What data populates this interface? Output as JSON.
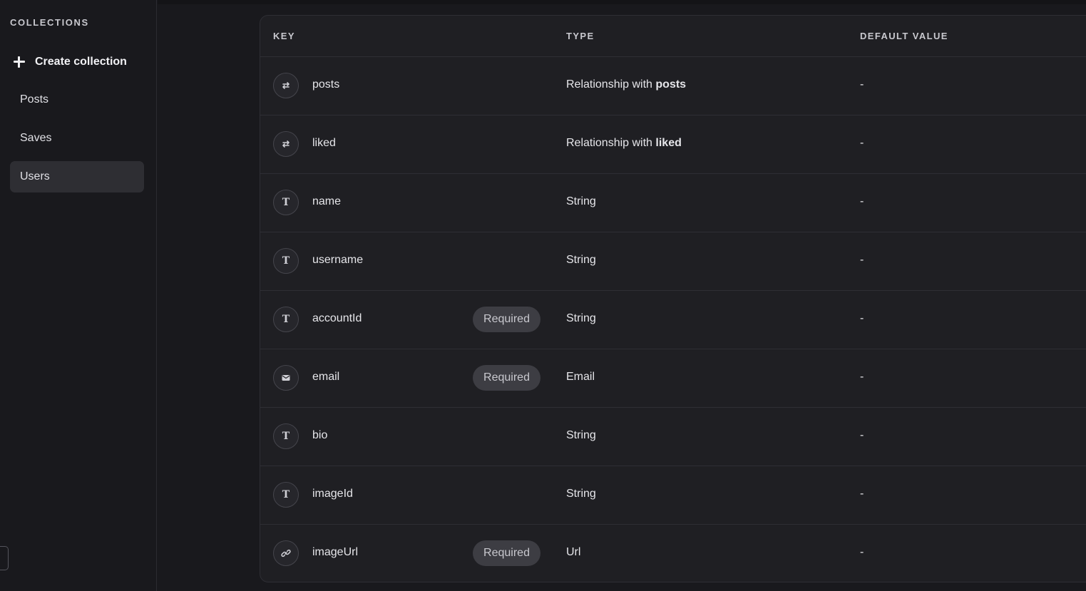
{
  "sidebar": {
    "section_title": "COLLECTIONS",
    "create_label": "Create collection",
    "items": [
      {
        "label": "Posts"
      },
      {
        "label": "Saves"
      },
      {
        "label": "Users",
        "active": true
      }
    ]
  },
  "table": {
    "headers": {
      "key": "KEY",
      "type": "TYPE",
      "default": "DEFAULT VALUE"
    },
    "rows": [
      {
        "icon": "relationship-icon",
        "key": "posts",
        "required": "",
        "type_prefix": "Relationship with ",
        "type_bold": "posts",
        "default": "-"
      },
      {
        "icon": "relationship-icon",
        "key": "liked",
        "required": "",
        "type_prefix": "Relationship with ",
        "type_bold": "liked",
        "default": "-"
      },
      {
        "icon": "text-type-icon",
        "key": "name",
        "required": "",
        "type_prefix": "String",
        "type_bold": "",
        "default": "-"
      },
      {
        "icon": "text-type-icon",
        "key": "username",
        "required": "",
        "type_prefix": "String",
        "type_bold": "",
        "default": "-"
      },
      {
        "icon": "text-type-icon",
        "key": "accountId",
        "required": "Required",
        "type_prefix": "String",
        "type_bold": "",
        "default": "-"
      },
      {
        "icon": "email-icon",
        "key": "email",
        "required": "Required",
        "type_prefix": "Email",
        "type_bold": "",
        "default": "-"
      },
      {
        "icon": "text-type-icon",
        "key": "bio",
        "required": "",
        "type_prefix": "String",
        "type_bold": "",
        "default": "-"
      },
      {
        "icon": "text-type-icon",
        "key": "imageId",
        "required": "",
        "type_prefix": "String",
        "type_bold": "",
        "default": "-"
      },
      {
        "icon": "link-icon",
        "key": "imageUrl",
        "required": "Required",
        "type_prefix": "Url",
        "type_bold": "",
        "default": "-"
      }
    ]
  },
  "colors": {
    "background": "#19191d",
    "panel": "#1f1f23",
    "active_item": "#2e2e33",
    "badge": "#3d3d43"
  }
}
